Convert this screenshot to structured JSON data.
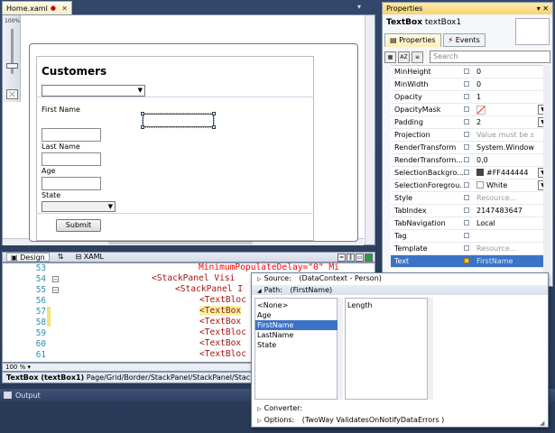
{
  "doc_tab": {
    "title": "Home.xaml"
  },
  "designer": {
    "zoom_label": "100%",
    "fit_glyph": "⤫",
    "form": {
      "heading": "Customers",
      "first_name_label": "First Name",
      "last_name_label": "Last Name",
      "age_label": "Age",
      "state_label": "State",
      "submit_label": "Submit"
    }
  },
  "view_tabs": {
    "design": "Design",
    "swap": "⇅",
    "xaml": "XAML"
  },
  "code": {
    "lines": [
      {
        "num": "53",
        "text": "MinimumPopulateDelay=\"0\" Mi"
      },
      {
        "num": "54",
        "text": "<StackPanel Visi"
      },
      {
        "num": "55",
        "text": "<StackPanel I"
      },
      {
        "num": "56",
        "text": "<TextBloc"
      },
      {
        "num": "57",
        "text": "<TextBox"
      },
      {
        "num": "58",
        "text": "<TextBox"
      },
      {
        "num": "59",
        "text": "<TextBloc"
      },
      {
        "num": "60",
        "text": "<TextBox"
      },
      {
        "num": "61",
        "text": "<TextBloc"
      }
    ],
    "zoom": "100 %"
  },
  "status": {
    "element": "TextBox (textBox1)",
    "path": "Page/Grid/Border/StackPanel/StackPanel/StackPan"
  },
  "output": {
    "label": "Output"
  },
  "properties": {
    "header": "Properties",
    "pin": "▾ ✕",
    "type": "TextBox",
    "name": "textBox1",
    "tabs": {
      "properties": "Properties",
      "events": "Events"
    },
    "search_placeholder": "Search",
    "rows": [
      {
        "name": "MinHeight",
        "value": "0"
      },
      {
        "name": "MinWidth",
        "value": "0"
      },
      {
        "name": "Opacity",
        "value": "1"
      },
      {
        "name": "OpacityMask",
        "value": ""
      },
      {
        "name": "Padding",
        "value": "2"
      },
      {
        "name": "Projection",
        "value": "Value must be set"
      },
      {
        "name": "RenderTransform",
        "value": "System.Windows"
      },
      {
        "name": "RenderTransform...",
        "value": "0,0"
      },
      {
        "name": "SelectionBackgro...",
        "value": "#FF444444"
      },
      {
        "name": "SelectionForegrou...",
        "value": "White"
      },
      {
        "name": "Style",
        "value": "Resource..."
      },
      {
        "name": "TabIndex",
        "value": "2147483647"
      },
      {
        "name": "TabNavigation",
        "value": "Local"
      },
      {
        "name": "Tag",
        "value": ""
      },
      {
        "name": "Template",
        "value": "Resource..."
      },
      {
        "name": "Text",
        "value": "FirstName"
      }
    ]
  },
  "binding": {
    "source_label": "Source:",
    "source_value": "(DataContext - Person)",
    "path_label": "Path:",
    "path_value": "(FirstName)",
    "path_items": [
      "<None>",
      "Age",
      "FirstName",
      "LastName",
      "State"
    ],
    "length_items": [
      "Length"
    ],
    "converter_label": "Converter:",
    "options_label": "Options:",
    "options_value": "(TwoWay ValidatesOnNotifyDataErrors )"
  },
  "colors": {
    "selection": "#3b73c7",
    "swatch_dark": "#444444"
  }
}
